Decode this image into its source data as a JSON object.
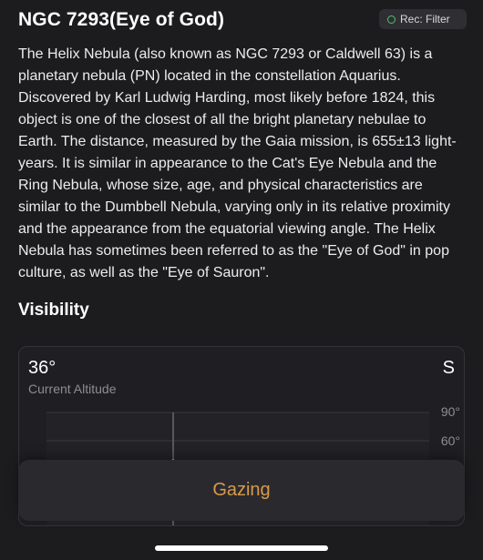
{
  "header": {
    "title": "NGC 7293(Eye of God)",
    "rec_filter_label": "Rec: Filter"
  },
  "description": "The Helix Nebula (also known as NGC 7293 or Caldwell 63) is a planetary nebula (PN) located in the constellation Aquarius. Discovered by Karl Ludwig Harding, most likely before 1824, this object is one of the closest of all the bright planetary nebulae to Earth. The distance, measured by the Gaia mission, is 655±13 light-years. It is similar in appearance to the Cat's Eye Nebula and the Ring Nebula, whose size, age, and physical characteristics are similar to the Dumbbell Nebula, varying only in its relative proximity and the appearance from the equatorial viewing angle. The Helix Nebula has sometimes been referred to as the \"Eye of God\" in pop culture, as well as the \"Eye of Sauron\".",
  "visibility": {
    "section_title": "Visibility",
    "current_altitude": "36°",
    "altitude_label": "Current Altitude",
    "direction": "S",
    "y_ticks": [
      "90°",
      "60°"
    ]
  },
  "gazing_button": {
    "label": "Gazing"
  },
  "colors": {
    "background": "#1c1c1f",
    "accent": "#d99a4a",
    "rec_dot": "#4fc06a"
  }
}
